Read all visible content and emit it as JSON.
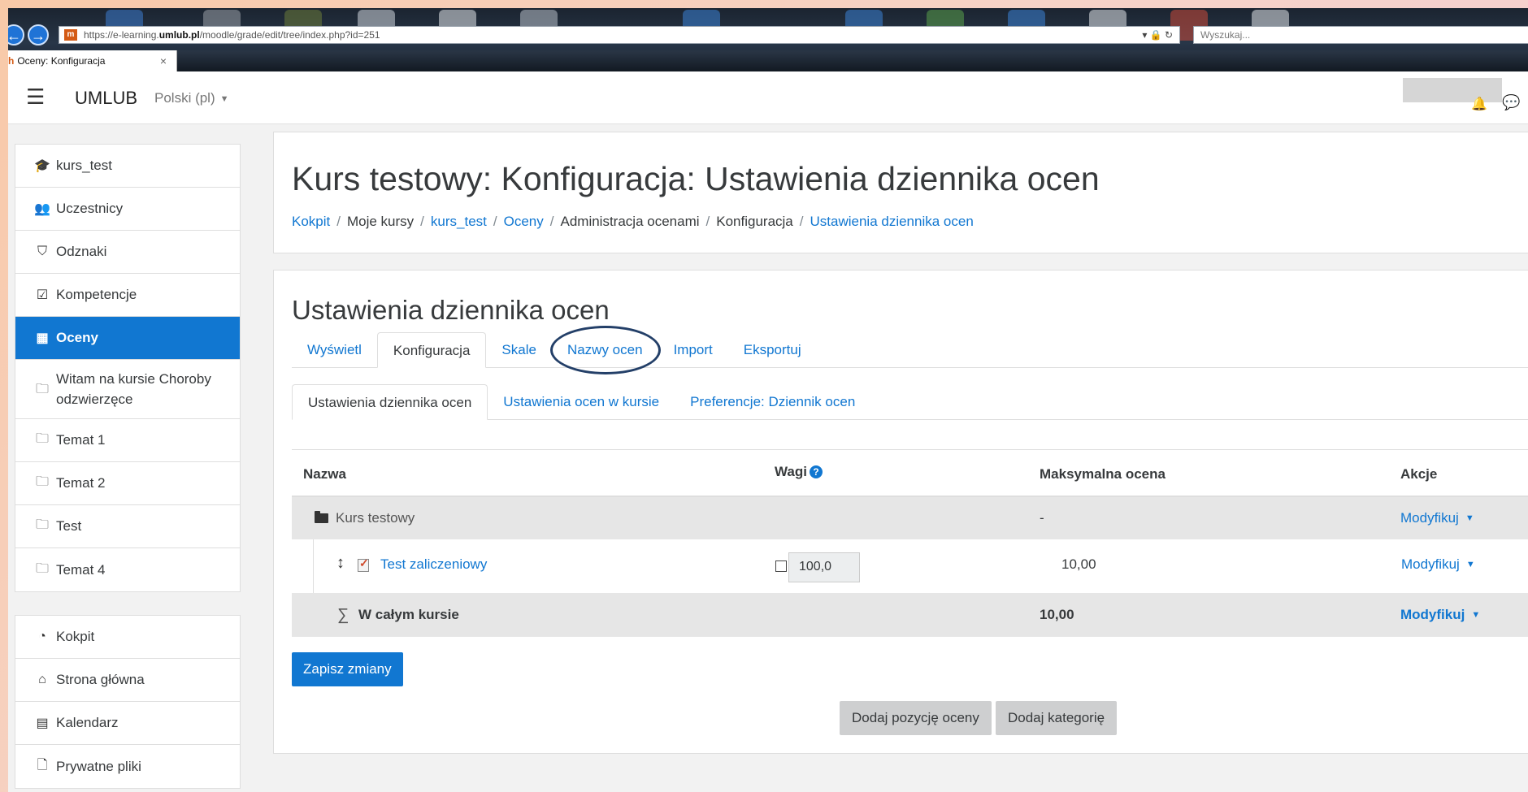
{
  "browser": {
    "url_prefix": "https://e-learning.",
    "url_host": "umlub.pl",
    "url_path": "/moodle/grade/edit/tree/index.php?id=251",
    "search_placeholder": "Wyszukaj...",
    "tab_title": "Oceny: Konfiguracja",
    "tab_close": "×"
  },
  "navbar": {
    "menu_icon": "hamburger-icon",
    "brand": "UMLUB",
    "language": "Polski (pl)"
  },
  "drawer": {
    "course_items": [
      {
        "icon": "graduation-cap-icon",
        "label": "kurs_test"
      },
      {
        "icon": "users-icon",
        "label": "Uczestnicy"
      },
      {
        "icon": "shield-icon",
        "label": "Odznaki"
      },
      {
        "icon": "checkbox-icon",
        "label": "Kompetencje"
      },
      {
        "icon": "table-icon",
        "label": "Oceny",
        "active": true
      },
      {
        "icon": "folder-icon",
        "label": "Witam na kursie Choroby odzwierzęce"
      },
      {
        "icon": "folder-icon",
        "label": "Temat 1"
      },
      {
        "icon": "folder-icon",
        "label": "Temat 2"
      },
      {
        "icon": "folder-icon",
        "label": "Test"
      },
      {
        "icon": "folder-icon",
        "label": "Temat 4"
      }
    ],
    "site_items": [
      {
        "icon": "dashboard-icon",
        "label": "Kokpit"
      },
      {
        "icon": "home-icon",
        "label": "Strona główna"
      },
      {
        "icon": "calendar-icon",
        "label": "Kalendarz"
      },
      {
        "icon": "file-icon",
        "label": "Prywatne pliki"
      }
    ]
  },
  "header": {
    "title": "Kurs testowy: Konfiguracja: Ustawienia dziennika ocen",
    "breadcrumb": [
      {
        "label": "Kokpit",
        "link": true
      },
      {
        "label": "Moje kursy",
        "link": false
      },
      {
        "label": "kurs_test",
        "link": true
      },
      {
        "label": "Oceny",
        "link": true
      },
      {
        "label": "Administracja ocenami",
        "link": false
      },
      {
        "label": "Konfiguracja",
        "link": false
      },
      {
        "label": "Ustawienia dziennika ocen",
        "link": true
      }
    ]
  },
  "main": {
    "section_title": "Ustawienia dziennika ocen",
    "tabs": [
      {
        "label": "Wyświetl"
      },
      {
        "label": "Konfiguracja",
        "active": true
      },
      {
        "label": "Skale"
      },
      {
        "label": "Nazwy ocen",
        "circled": true
      },
      {
        "label": "Import"
      },
      {
        "label": "Eksportuj"
      }
    ],
    "subtabs": [
      {
        "label": "Ustawienia dziennika ocen",
        "active": true
      },
      {
        "label": "Ustawienia ocen w kursie"
      },
      {
        "label": "Preferencje: Dziennik ocen"
      }
    ],
    "table": {
      "headers": {
        "name": "Nazwa",
        "weights": "Wagi",
        "help": "?",
        "max": "Maksymalna ocena",
        "actions": "Akcje"
      },
      "category": {
        "name": "Kurs testowy",
        "max": "-",
        "action": "Modyfikuj"
      },
      "item": {
        "name": "Test zaliczeniowy",
        "weight": "100,0",
        "max": "10,00",
        "action": "Modyfikuj"
      },
      "total": {
        "sigma": "∑",
        "name": "W całym kursie",
        "max": "10,00",
        "action": "Modyfikuj"
      }
    },
    "save_button": "Zapisz zmiany",
    "add_item_button": "Dodaj pozycję oceny",
    "add_category_button": "Dodaj kategorię"
  }
}
